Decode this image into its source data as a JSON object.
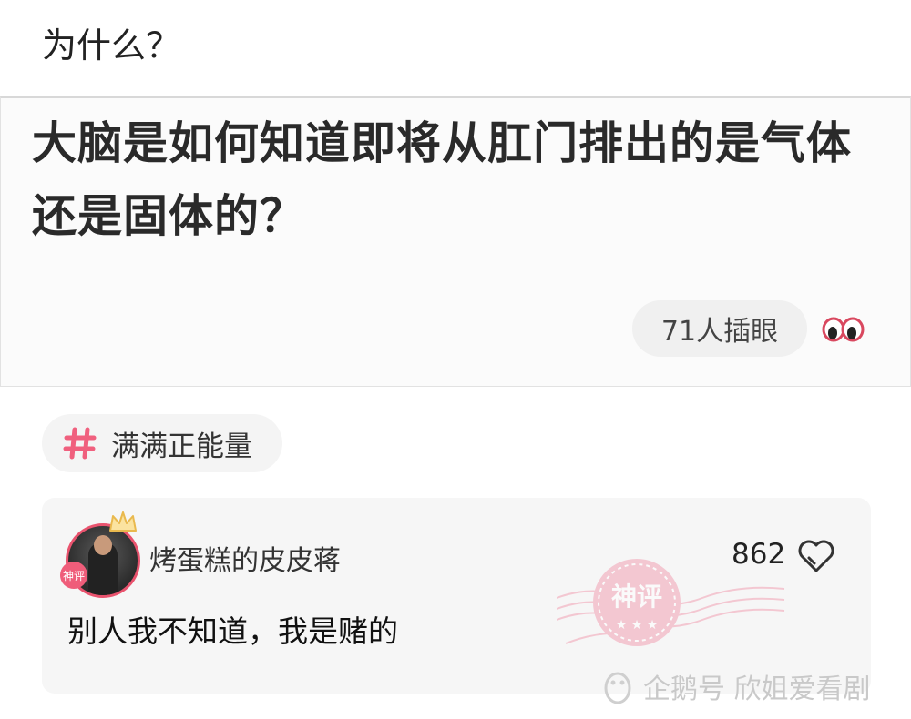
{
  "header": {
    "title": "为什么？"
  },
  "question": {
    "text": "大脑是如何知道即将从肛门排出的是气体还是固体的？",
    "watch_label": "71人插眼",
    "watch_icon": "eyes-icon"
  },
  "tag": {
    "label": "满满正能量",
    "icon": "hash-icon",
    "color": "#f0607e"
  },
  "comment": {
    "username": "烤蛋糕的皮皮蒋",
    "likes": "862",
    "text": "别人我不知道，我是赌的",
    "avatar_badge": "神评",
    "stamp_text": "神评"
  },
  "watermark": {
    "text": "企鹅号 欣姐爱看剧"
  },
  "colors": {
    "accent": "#f0607e",
    "stamp": "#f2a1b4"
  }
}
